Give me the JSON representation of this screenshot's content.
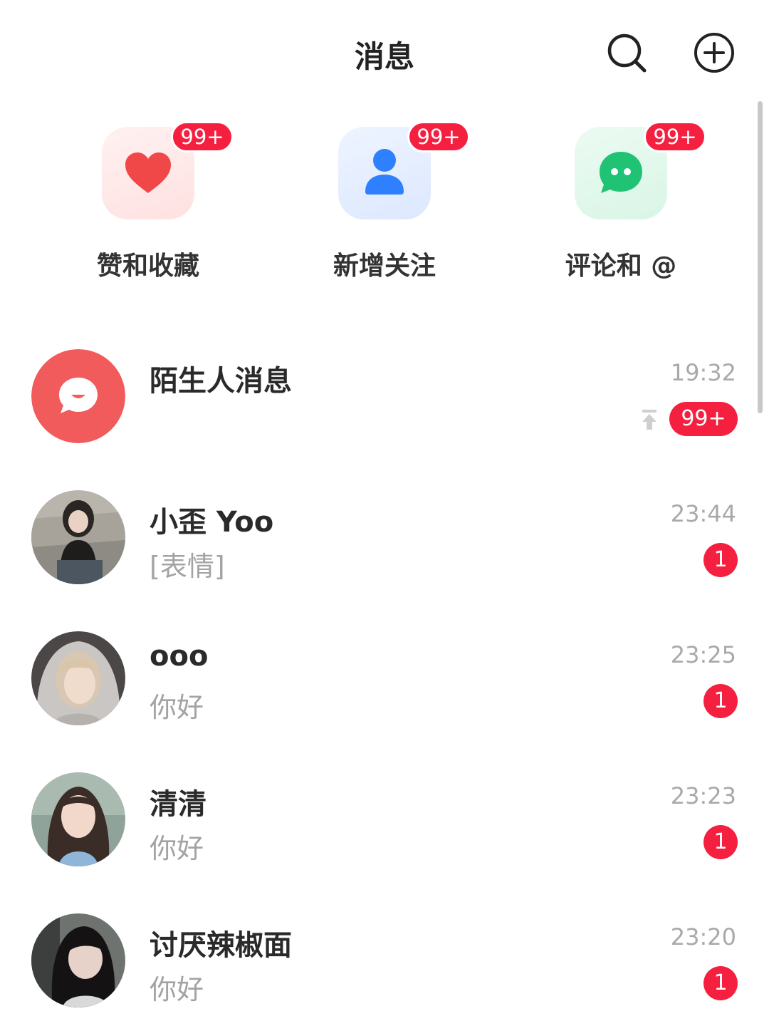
{
  "header": {
    "title": "消息",
    "search_icon": "search-icon",
    "add_icon": "plus-circle-icon"
  },
  "quick_actions": [
    {
      "label": "赞和收藏",
      "badge": "99+",
      "icon": "heart-icon",
      "color": "#f04848"
    },
    {
      "label": "新增关注",
      "badge": "99+",
      "icon": "person-icon",
      "color": "#2f80ff"
    },
    {
      "label": "评论和 @",
      "badge": "99+",
      "icon": "chat-bubble-icon",
      "color": "#20c374"
    }
  ],
  "messages": [
    {
      "name": "陌生人消息",
      "preview": "",
      "time": "19:32",
      "badge": "99+",
      "pinned": true,
      "avatar": "stranger-message-icon"
    },
    {
      "name": "小歪 Yoo",
      "preview": "[表情]",
      "time": "23:44",
      "badge": "1",
      "avatar": "user-avatar"
    },
    {
      "name": "ooo",
      "preview": "你好",
      "time": "23:25",
      "badge": "1",
      "avatar": "user-avatar"
    },
    {
      "name": "清清",
      "preview": "你好",
      "time": "23:23",
      "badge": "1",
      "avatar": "user-avatar"
    },
    {
      "name": "讨厌辣椒面",
      "preview": "你好",
      "time": "23:20",
      "badge": "1",
      "avatar": "user-avatar"
    }
  ],
  "colors": {
    "badge": "#f5203f",
    "stranger_avatar": "#f25b5b"
  }
}
